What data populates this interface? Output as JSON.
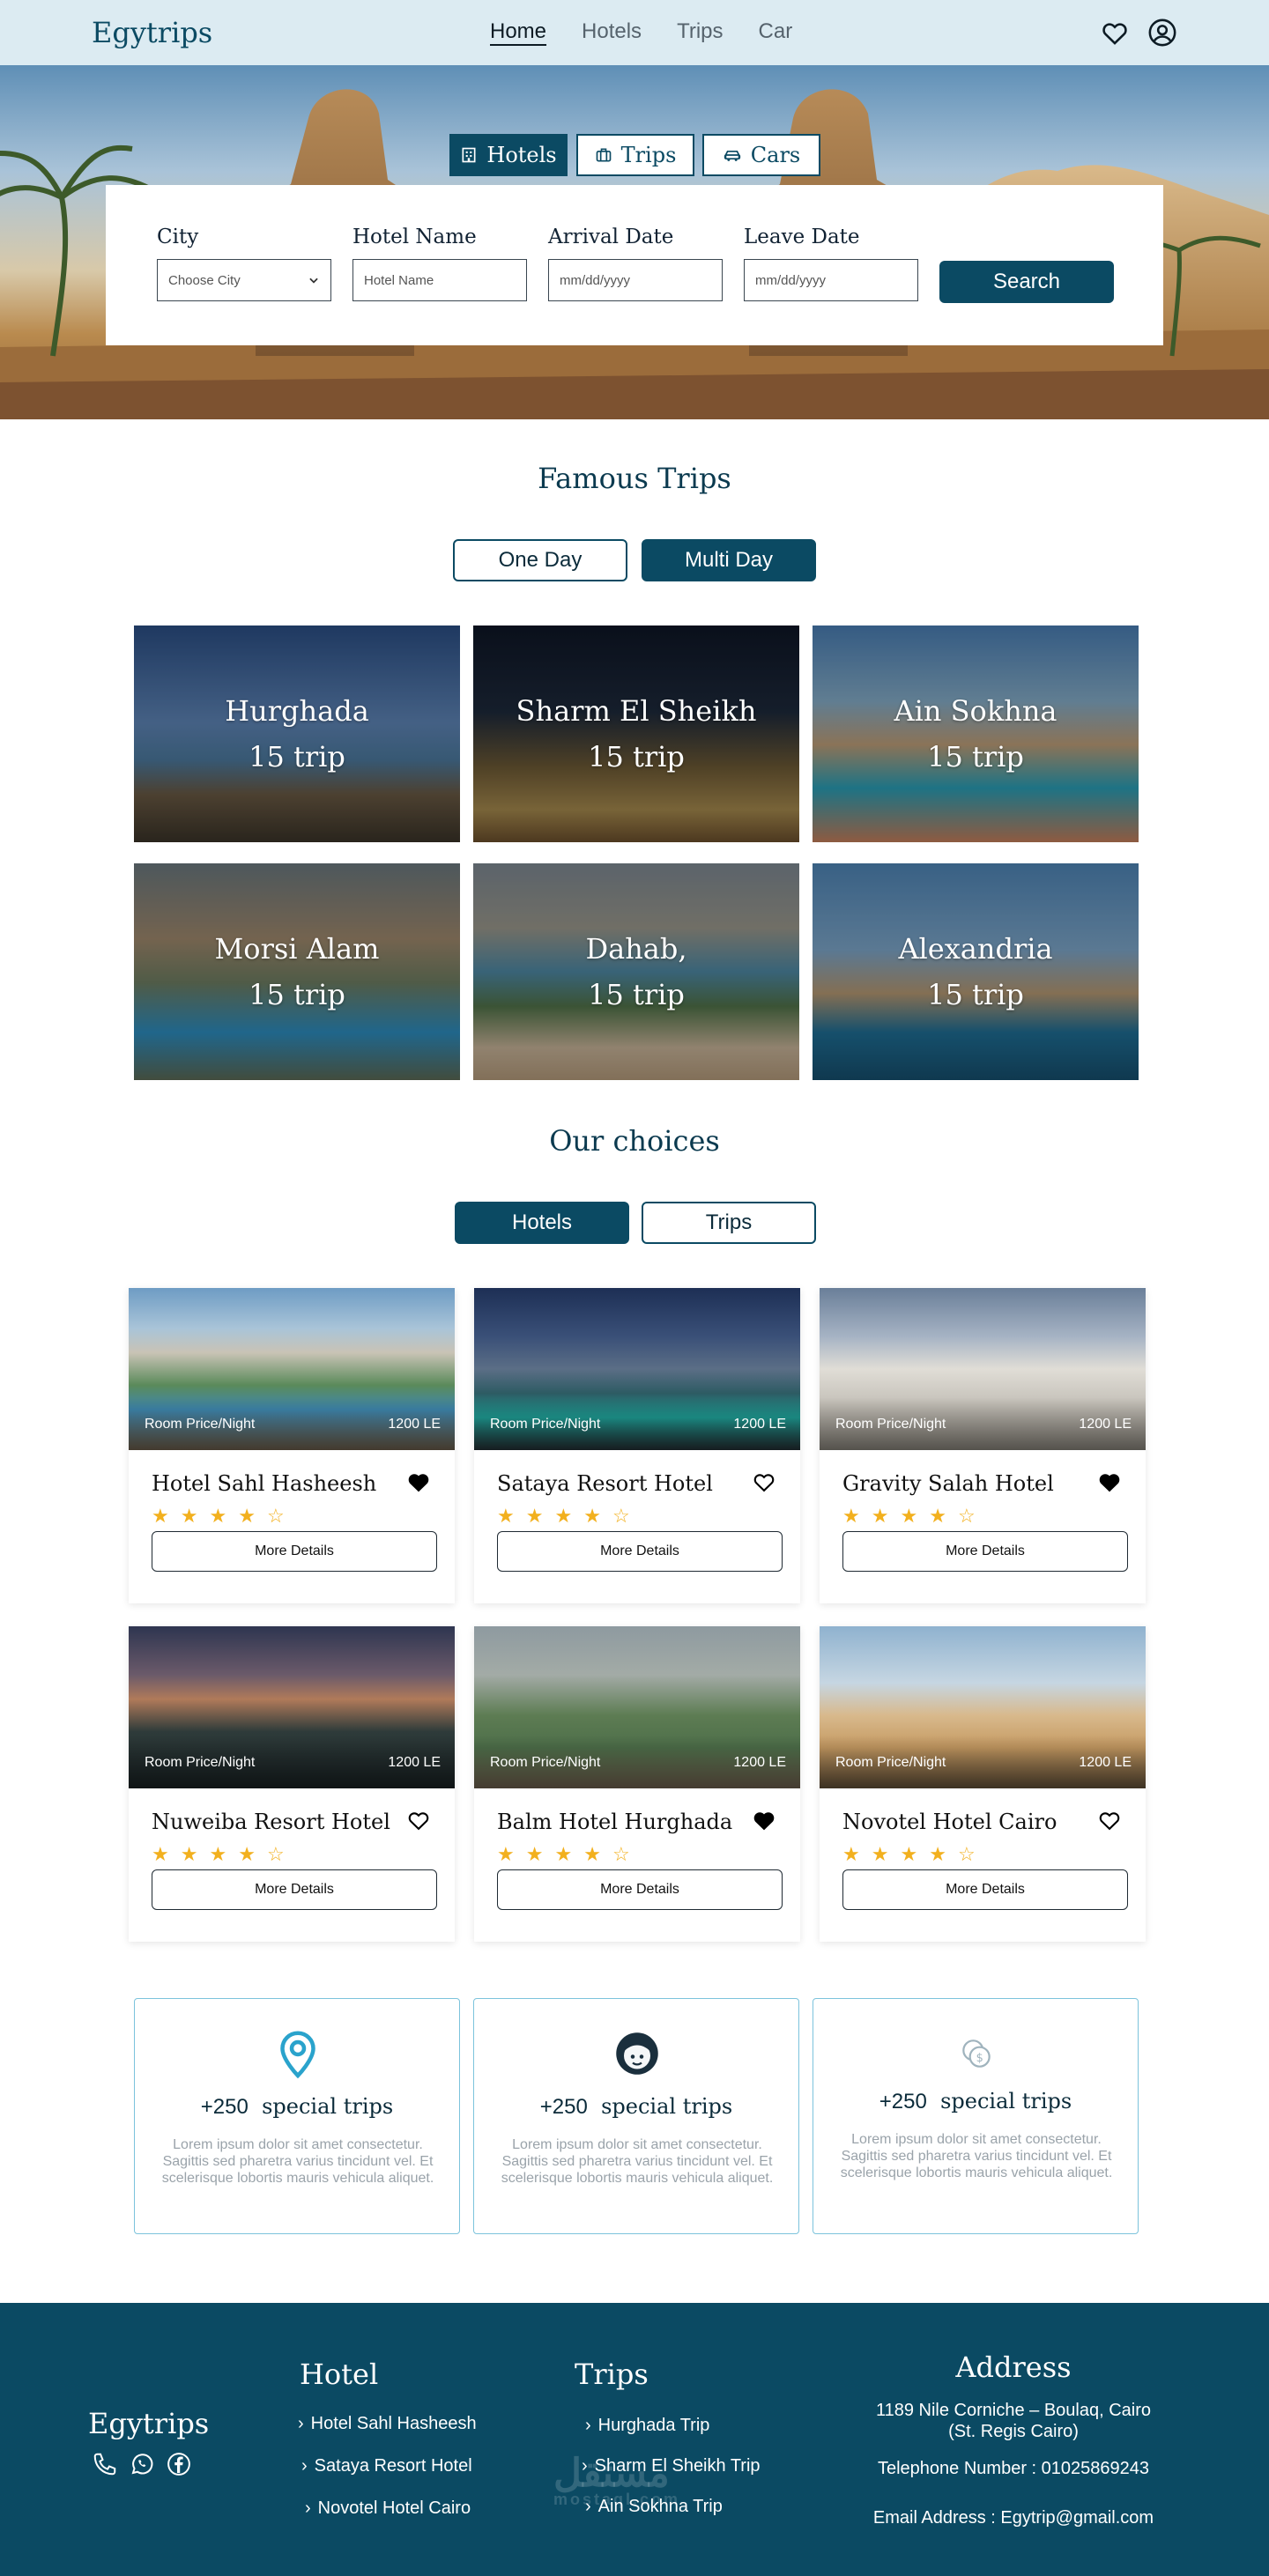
{
  "nav": {
    "logo": "Egytrips",
    "links": [
      "Home",
      "Hotels",
      "Trips",
      "Car"
    ],
    "active": "Home",
    "icons": [
      "heart-icon",
      "user-icon"
    ]
  },
  "hero": {
    "tabs": [
      {
        "label": "Hotels",
        "icon": "building-icon",
        "active": true
      },
      {
        "label": "Trips",
        "icon": "suitcase-icon",
        "active": false
      },
      {
        "label": "Cars",
        "icon": "car-icon",
        "active": false
      }
    ],
    "fields": [
      {
        "label": "City",
        "value": "Choose City",
        "type": "select"
      },
      {
        "label": "Hotel Name",
        "placeholder": "Hotel Name",
        "type": "text"
      },
      {
        "label": "Arrival Date",
        "placeholder": "mm/dd/yyyy",
        "type": "date"
      },
      {
        "label": "Leave Date",
        "placeholder": "mm/dd/yyyy",
        "type": "date"
      }
    ],
    "search_label": "Search"
  },
  "famous": {
    "title": "Famous Trips",
    "toggle": [
      "One Day",
      "Multi Day"
    ],
    "active_toggle": "Multi Day",
    "trips": [
      {
        "name": "Hurghada",
        "count": "15 trip"
      },
      {
        "name": "Sharm El Sheikh",
        "count": "15 trip"
      },
      {
        "name": "Ain Sokhna",
        "count": "15 trip"
      },
      {
        "name": "Morsi Alam",
        "count": "15 trip"
      },
      {
        "name": "Dahab,",
        "count": "15 trip"
      },
      {
        "name": "Alexandria",
        "count": "15 trip"
      }
    ]
  },
  "choices": {
    "title": "Our choices",
    "toggle": [
      "Hotels",
      "Trips"
    ],
    "active_toggle": "Hotels",
    "price_label": "Room Price/Night",
    "details_label": "More Details",
    "hotels": [
      {
        "name": "Hotel Sahl Hasheesh",
        "price": "1200 LE",
        "rating": 4,
        "favorite": true
      },
      {
        "name": "Sataya Resort Hotel",
        "price": "1200 LE",
        "rating": 4,
        "favorite": false
      },
      {
        "name": "Gravity Salah Hotel",
        "price": "1200 LE",
        "rating": 4,
        "favorite": true
      },
      {
        "name": "Nuweiba Resort Hotel",
        "price": "1200 LE",
        "rating": 4,
        "favorite": false
      },
      {
        "name": "Balm Hotel Hurghada",
        "price": "1200 LE",
        "rating": 4,
        "favorite": true
      },
      {
        "name": "Novotel Hotel Cairo",
        "price": "1200 LE",
        "rating": 4,
        "favorite": false
      }
    ]
  },
  "features": [
    {
      "icon": "location-pin-icon",
      "count": "+250",
      "label": "special trips",
      "text": "Lorem ipsum dolor sit amet consectetur. Sagittis sed pharetra varius tincidunt vel. Et scelerisque lobortis mauris vehicula aliquet."
    },
    {
      "icon": "support-agent-icon",
      "count": "+250",
      "label": "special trips",
      "text": "Lorem ipsum dolor sit amet consectetur. Sagittis sed pharetra varius tincidunt vel. Et scelerisque lobortis mauris vehicula aliquet."
    },
    {
      "icon": "coins-icon",
      "count": "+250",
      "label": "special trips",
      "text": "Lorem ipsum dolor sit amet consectetur. Sagittis sed pharetra varius tincidunt vel. Et scelerisque lobortis mauris vehicula aliquet."
    }
  ],
  "footer": {
    "logo": "Egytrips",
    "social": [
      "phone-icon",
      "whatsapp-icon",
      "facebook-icon"
    ],
    "hotel_title": "Hotel",
    "hotels": [
      "Hotel Sahl Hasheesh",
      "Sataya Resort Hotel",
      "Novotel Hotel Cairo"
    ],
    "trips_title": "Trips",
    "trips": [
      "Hurghada Trip",
      "Sharm El Sheikh Trip",
      "Ain Sokhna Trip"
    ],
    "address_title": "Address",
    "address_line1": "1189 Nile Corniche – Boulaq, Cairo",
    "address_line2": "(St. Regis Cairo)",
    "phone": "Telephone Number : 01025869243",
    "email": "Email Address : Egytrip@gmail.com",
    "watermark": "مستقل",
    "watermark_latin": "mostaql.com"
  },
  "colors": {
    "primary": "#0b4a63",
    "nav_bg": "#dcebf2",
    "star": "#f2b01e",
    "feature_border": "#7cc3dc"
  }
}
